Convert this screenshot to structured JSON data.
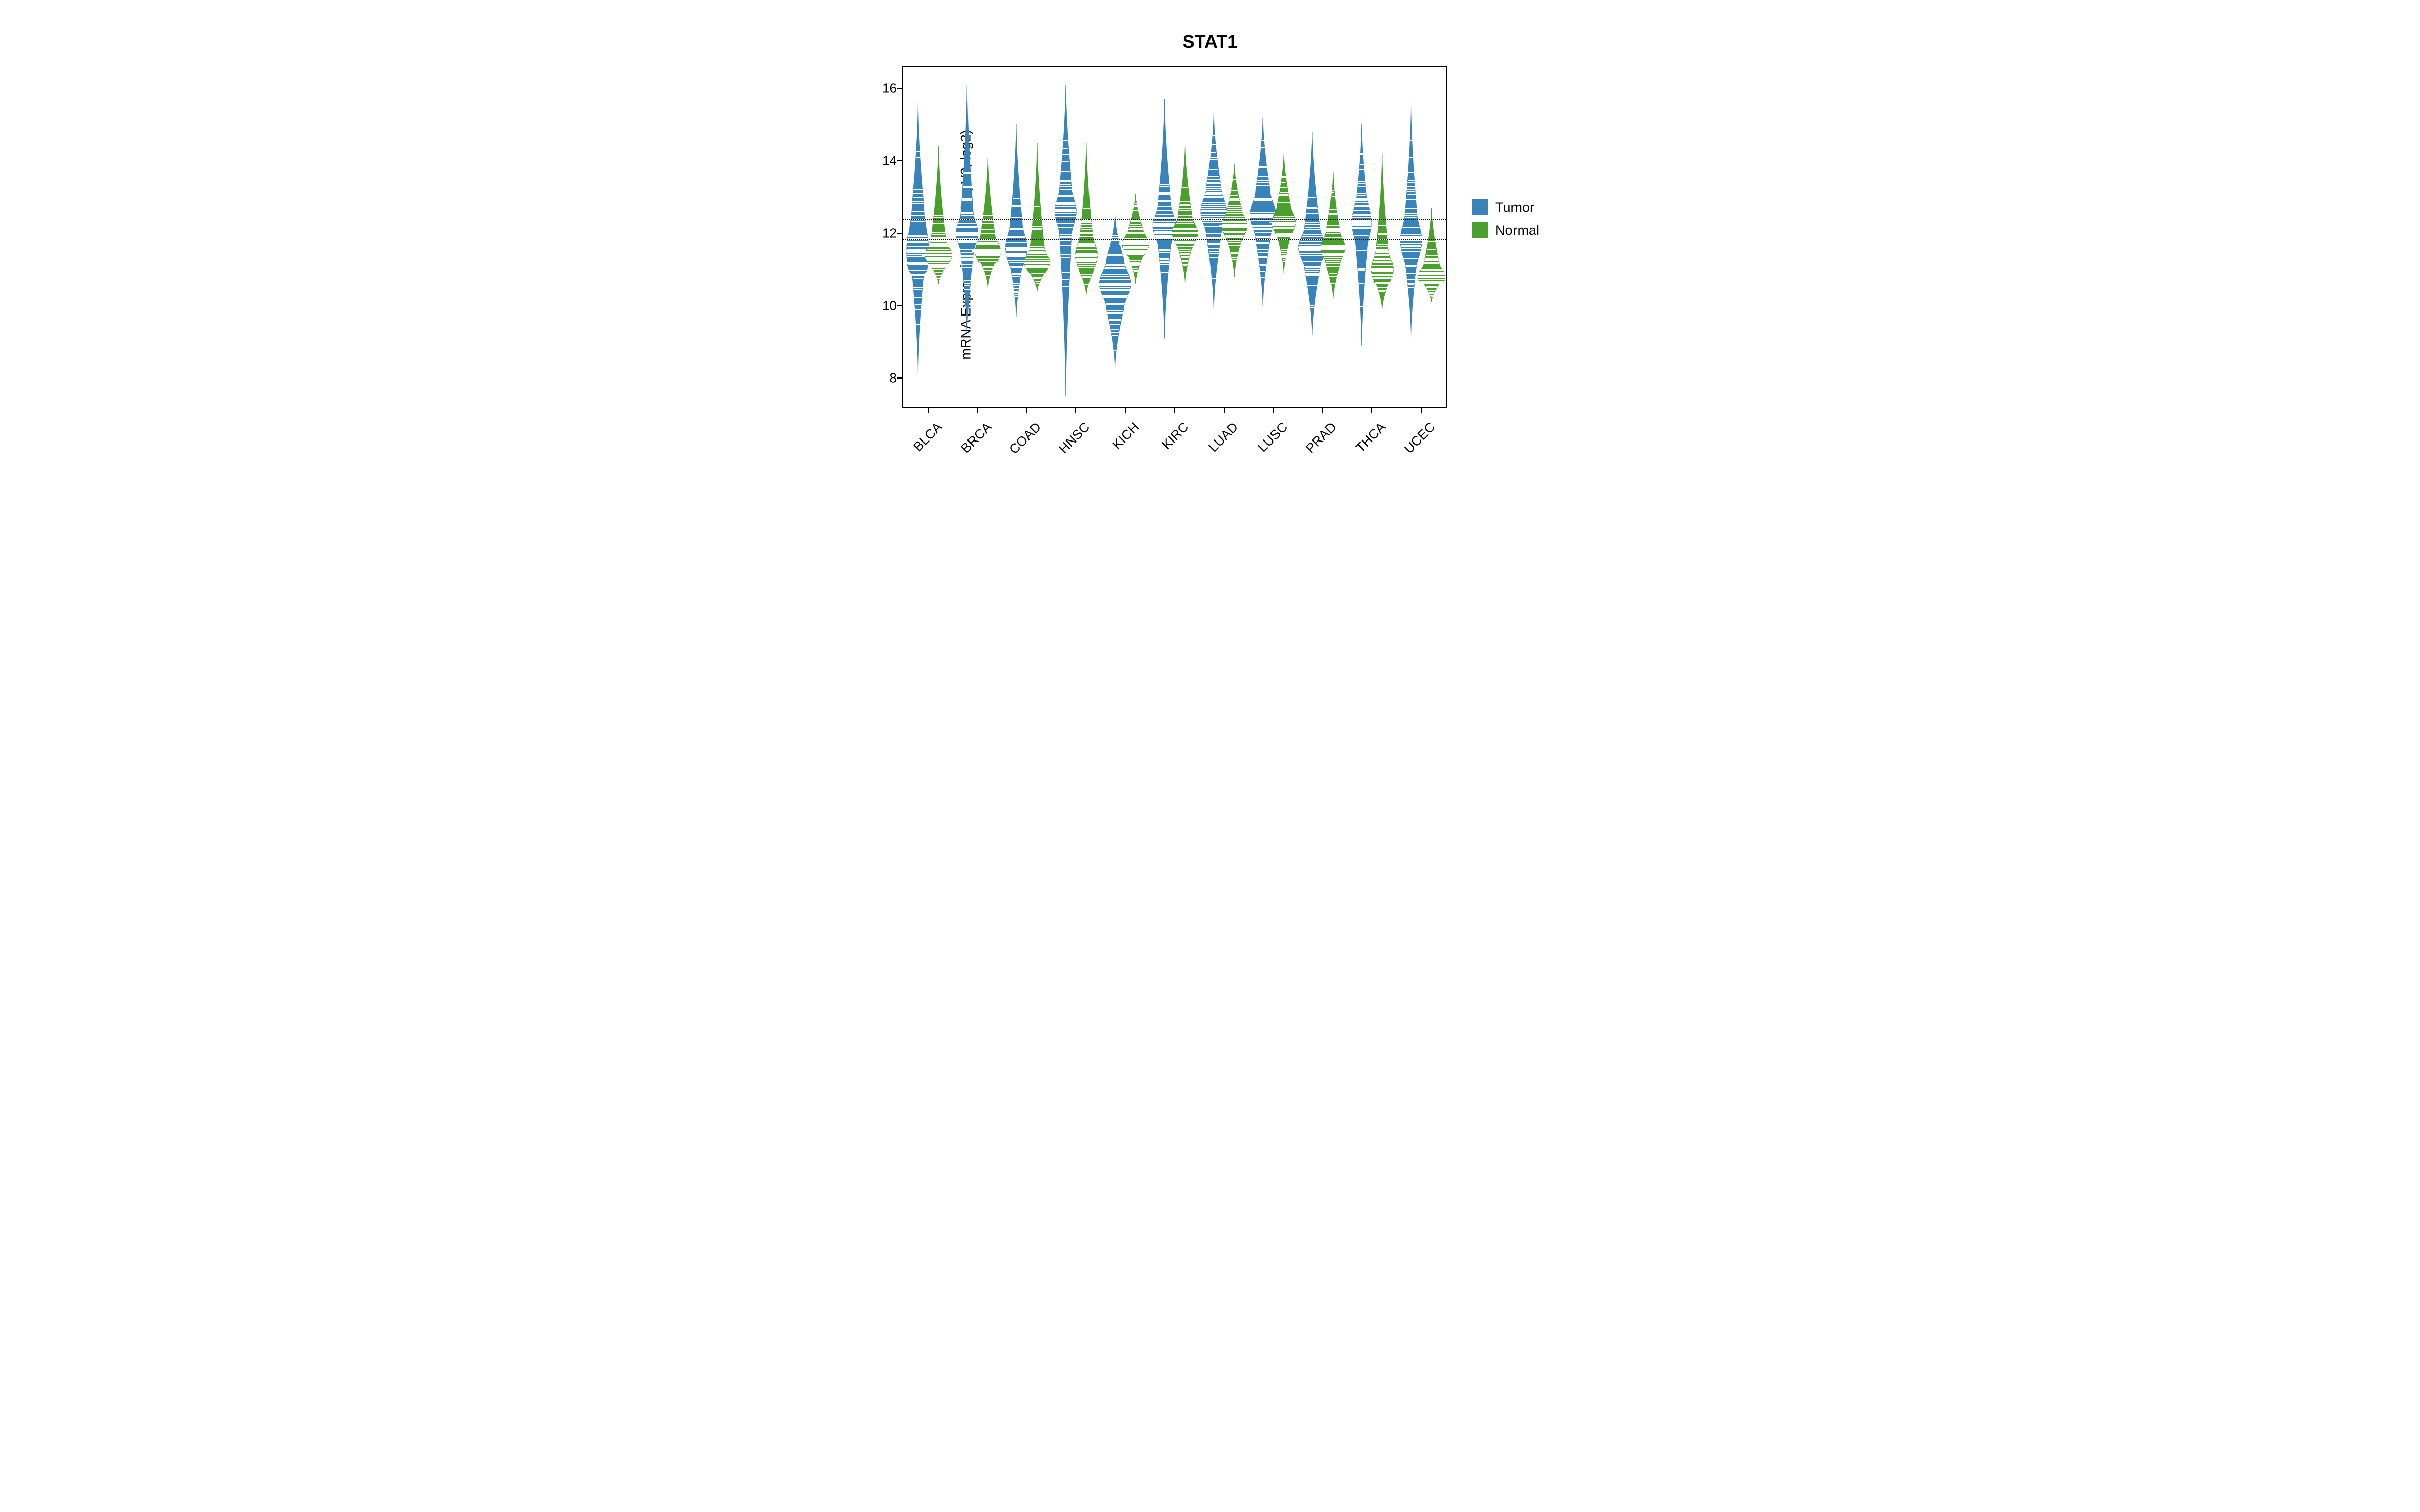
{
  "chart_data": {
    "type": "bean",
    "title": "STAT1",
    "ylabel": "mRNA Expression (RNASeq V2, log2)",
    "xlabel": "",
    "ylim": [
      7.2,
      16.6
    ],
    "y_ticks": [
      8,
      10,
      12,
      14,
      16
    ],
    "reference_lines": [
      12.4,
      11.85
    ],
    "categories": [
      "BLCA",
      "BRCA",
      "COAD",
      "HNSC",
      "KICH",
      "KIRC",
      "LUAD",
      "LUSC",
      "PRAD",
      "THCA",
      "UCEC"
    ],
    "series": [
      {
        "name": "Tumor",
        "color": "#3983bb",
        "distributions": [
          {
            "min": 8.1,
            "q1": 10.9,
            "median": 11.5,
            "q3": 12.8,
            "max": 15.6,
            "max_width": 0.55
          },
          {
            "min": 9.2,
            "q1": 11.4,
            "median": 12.0,
            "q3": 12.6,
            "max": 16.1,
            "max_width": 0.55
          },
          {
            "min": 9.7,
            "q1": 11.1,
            "median": 11.6,
            "q3": 12.3,
            "max": 15.0,
            "max_width": 0.55
          },
          {
            "min": 7.5,
            "q1": 11.9,
            "median": 12.6,
            "q3": 13.3,
            "max": 16.1,
            "max_width": 0.55
          },
          {
            "min": 8.3,
            "q1": 9.9,
            "median": 10.6,
            "q3": 11.3,
            "max": 12.5,
            "max_width": 0.8
          },
          {
            "min": 9.1,
            "q1": 11.7,
            "median": 12.2,
            "q3": 12.8,
            "max": 15.7,
            "max_width": 0.6
          },
          {
            "min": 9.9,
            "q1": 11.9,
            "median": 12.6,
            "q3": 13.3,
            "max": 15.3,
            "max_width": 0.65
          },
          {
            "min": 10.0,
            "q1": 11.8,
            "median": 12.5,
            "q3": 13.2,
            "max": 15.2,
            "max_width": 0.65
          },
          {
            "min": 9.2,
            "q1": 11.0,
            "median": 11.6,
            "q3": 12.2,
            "max": 14.8,
            "max_width": 0.7
          },
          {
            "min": 8.9,
            "q1": 11.5,
            "median": 12.3,
            "q3": 12.9,
            "max": 15.0,
            "max_width": 0.5
          },
          {
            "min": 9.1,
            "q1": 11.2,
            "median": 11.8,
            "q3": 12.6,
            "max": 15.6,
            "max_width": 0.55
          }
        ]
      },
      {
        "name": "Normal",
        "color": "#4aa02c",
        "distributions": [
          {
            "min": 10.6,
            "q1": 11.1,
            "median": 11.4,
            "q3": 11.8,
            "max": 14.4,
            "max_width": 0.7
          },
          {
            "min": 10.5,
            "q1": 11.2,
            "median": 11.5,
            "q3": 12.0,
            "max": 14.1,
            "max_width": 0.65
          },
          {
            "min": 10.4,
            "q1": 10.9,
            "median": 11.2,
            "q3": 11.6,
            "max": 14.5,
            "max_width": 0.65
          },
          {
            "min": 10.3,
            "q1": 10.9,
            "median": 11.4,
            "q3": 12.0,
            "max": 14.5,
            "max_width": 0.55
          },
          {
            "min": 10.6,
            "q1": 11.4,
            "median": 11.7,
            "q3": 12.1,
            "max": 13.1,
            "max_width": 0.7
          },
          {
            "min": 10.6,
            "q1": 11.6,
            "median": 12.0,
            "q3": 12.5,
            "max": 14.5,
            "max_width": 0.65
          },
          {
            "min": 10.8,
            "q1": 11.8,
            "median": 12.2,
            "q3": 12.7,
            "max": 13.9,
            "max_width": 0.65
          },
          {
            "min": 10.9,
            "q1": 11.9,
            "median": 12.3,
            "q3": 12.8,
            "max": 14.2,
            "max_width": 0.6
          },
          {
            "min": 10.2,
            "q1": 11.1,
            "median": 11.6,
            "q3": 12.1,
            "max": 13.7,
            "max_width": 0.6
          },
          {
            "min": 9.9,
            "q1": 10.6,
            "median": 11.0,
            "q3": 11.6,
            "max": 14.2,
            "max_width": 0.55
          },
          {
            "min": 10.1,
            "q1": 10.6,
            "median": 10.8,
            "q3": 11.2,
            "max": 12.7,
            "max_width": 0.7
          }
        ]
      }
    ],
    "legend": [
      "Tumor",
      "Normal"
    ]
  }
}
